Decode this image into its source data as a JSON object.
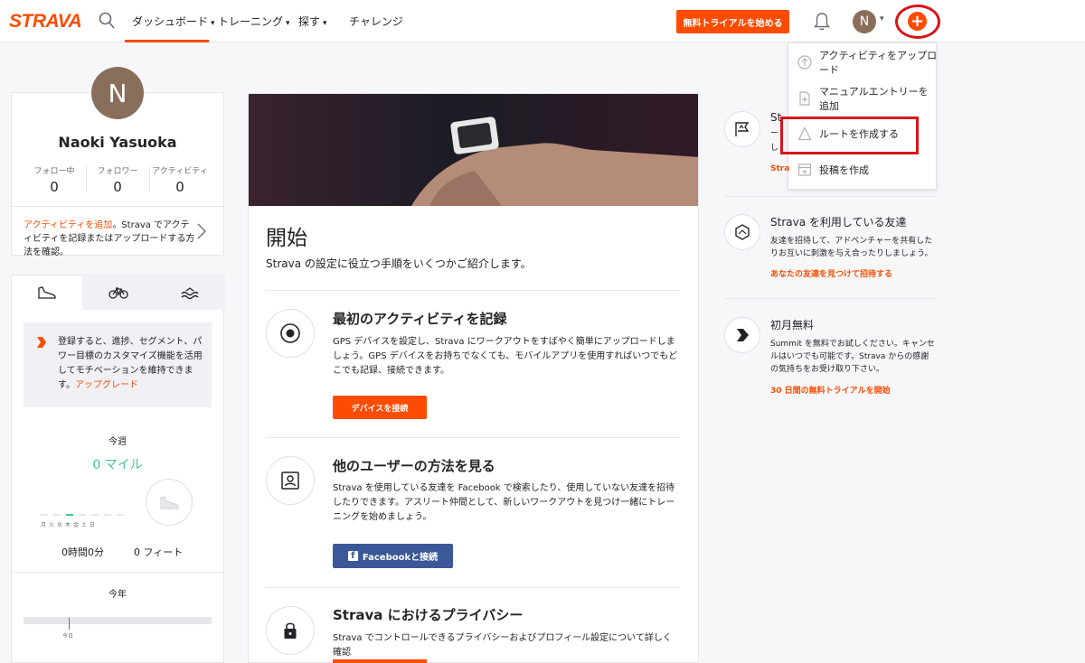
{
  "header": {
    "logo": "STRAVA",
    "nav": [
      {
        "label": "ダッシュボード",
        "caret": "⌄"
      },
      {
        "label": "トレーニング",
        "caret": "⌄"
      },
      {
        "label": "探す",
        "caret": "⌄"
      },
      {
        "label": "チャレンジ"
      }
    ],
    "trial_button": "無料トライアルを始める",
    "avatar_initial": "N",
    "plus_symbol": "+",
    "brand_color": "#fc4c02"
  },
  "dropdown": {
    "items": [
      {
        "label": "アクティビティをアップロード",
        "icon": "upload-icon"
      },
      {
        "label": "マニュアルエントリーを追加",
        "icon": "manual-entry-icon"
      },
      {
        "label": "ルートを作成する",
        "icon": "route-icon"
      },
      {
        "label": "投稿を作成",
        "icon": "post-icon"
      }
    ]
  },
  "profile": {
    "initial": "N",
    "name": "Naoki Yasuoka",
    "stats": [
      {
        "label": "フォロー中",
        "value": "0"
      },
      {
        "label": "フォロワー",
        "value": "0"
      },
      {
        "label": "アクティビティ",
        "value": "0"
      }
    ],
    "add_activity_link": "アクティビティを追加",
    "add_activity_text": "。Strava でアクティビティを記録またはアップロードする方法を確認。"
  },
  "sport": {
    "tabs": [
      "running-shoe-icon",
      "bike-icon",
      "swim-icon"
    ],
    "upgrade_text": "登録すると、進捗、セグメント、パワー目標のカスタマイズ機能を活用してモチベーションを維持できます。",
    "upgrade_link": "アップグレード",
    "week_label": "今週",
    "week_miles": "0 マイル",
    "days": "月火水木金土日",
    "week_time": "0時間0分",
    "week_elev": "0 フィート",
    "year_label": "今年",
    "today_label": "今日"
  },
  "main": {
    "title": "開始",
    "subtitle": "Strava の設定に役立つ手順をいくつかご紹介します。",
    "steps": [
      {
        "title": "最初のアクティビティを記録",
        "desc": "GPS デバイスを設定し、Strava にワークアウトをすばやく簡単にアップロードしましょう。GPS デバイスをお持ちでなくても、モバイルアプリを使用すればいつでもどこでも記録、接続できます。",
        "button": "デバイスを接続"
      },
      {
        "title": "他のユーザーの方法を見る",
        "desc": "Strava を使用している友達を Facebook で検索したり、使用していない友達を招待したりできます。アスリート仲間として、新しいワークアウトを見つけ一緒にトレーニングを始めましょう。",
        "button": "Facebookと接続"
      },
      {
        "title": "Strava におけるプライバシー",
        "desc": "Strava でコントロールできるプライバシーおよびプロフィール設定について詳しく確認"
      }
    ]
  },
  "right": {
    "partial_title": "St",
    "partial_line": "ー",
    "partial_line2": "し",
    "partial_link": "Stra",
    "friends": {
      "title": "Strava を利用している友達",
      "desc": "友達を招待して、アドベンチャーを共有したりお互いに刺激を与え合ったりしましょう。",
      "link": "あなたの友達を見つけて招待する"
    },
    "free": {
      "title": "初月無料",
      "desc": "Summit を無料でお試しください。キャンセルはいつでも可能です。Strava からの感謝の気持ちをお受け取り下さい。",
      "link": "30 日間の無料トライアルを開始"
    }
  }
}
